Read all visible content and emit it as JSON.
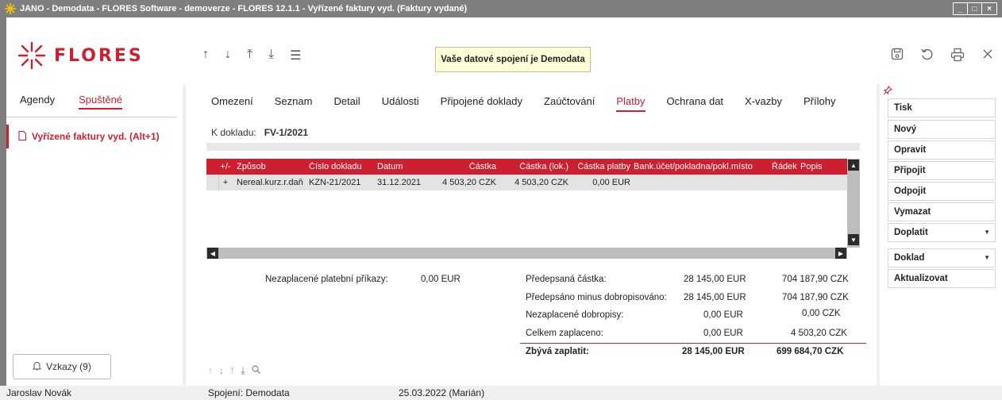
{
  "window": {
    "title": "JANO - Demodata - FLORES Software - demoverze - FLORES 12.1.1 - Vyřízené faktury vyd.  (Faktury vydané)",
    "controls": [
      "_",
      "□",
      "×"
    ]
  },
  "toolbar": {
    "logo_text": "FLORES",
    "nav_icons": [
      "arrow-up-icon",
      "arrow-down-icon",
      "arrow-first-icon",
      "arrow-last-icon",
      "menu-icon"
    ],
    "connection_banner": "Vaše datové spojení je Demodata",
    "right_icons": [
      "save-icon",
      "undo-icon",
      "print-icon",
      "close-icon"
    ]
  },
  "left_panel": {
    "tabs": [
      {
        "label": "Agendy",
        "active": false
      },
      {
        "label": "Spuštěné",
        "active": true
      }
    ],
    "items": [
      {
        "label": "Vyřízené faktury vyd. (Alt+1)"
      }
    ],
    "messages_button": "Vzkazy (9)"
  },
  "main": {
    "tabs": [
      {
        "label": "Omezení",
        "active": false
      },
      {
        "label": "Seznam",
        "active": false
      },
      {
        "label": "Detail",
        "active": false
      },
      {
        "label": "Události",
        "active": false
      },
      {
        "label": "Připojené doklady",
        "active": false
      },
      {
        "label": "Zaúčtování",
        "active": false
      },
      {
        "label": "Platby",
        "active": true
      },
      {
        "label": "Ochrana dat",
        "active": false
      },
      {
        "label": "X-vazby",
        "active": false
      },
      {
        "label": "Přílohy",
        "active": false
      }
    ],
    "doc_label": "K dokladu:",
    "doc_number": "FV-1/2021",
    "grid": {
      "columns": [
        "+/-",
        "Způsob",
        "Číslo dokladu",
        "Datum",
        "Částka",
        "Částka (lok.)",
        "Částka platby",
        "Bank.účet/pokladna/pokl.místo",
        "Řádek",
        "Popis"
      ],
      "rows": [
        [
          "+",
          "Nereal.kurz.r.daň",
          "KZN-21/2021",
          "31.12.2021",
          "4 503,20 CZK",
          "4 503,20 CZK",
          "0,00 EUR",
          "",
          "",
          ""
        ]
      ]
    },
    "summary": {
      "unpaid_orders_label": "Nezaplacené platební příkazy:",
      "unpaid_orders_value": "0,00 EUR",
      "lines": [
        {
          "label": "Předepsaná částka:",
          "eur": "28 145,00 EUR",
          "czk": "704 187,90 CZK"
        },
        {
          "label": "Předepsáno minus dobropisováno:",
          "eur": "28 145,00 EUR",
          "czk": "704 187,90 CZK"
        },
        {
          "label": "Nezaplacené dobropisy:",
          "eur": "0,00 EUR",
          "czk": "0,00 CZK"
        },
        {
          "label": "Celkem zaplaceno:",
          "eur": "0,00 EUR",
          "czk": "4 503,20 CZK"
        }
      ],
      "remaining": {
        "label": "Zbývá zaplatit:",
        "eur": "28 145,00 EUR",
        "czk": "699 684,70 CZK"
      }
    }
  },
  "right_panel": {
    "buttons": [
      {
        "label": "Tisk"
      },
      {
        "label": "Nový"
      },
      {
        "label": "Opravit"
      },
      {
        "label": "Připojit"
      },
      {
        "label": "Odpojit"
      },
      {
        "label": "Vymazat"
      },
      {
        "label": "Doplatit"
      },
      {
        "label": "Doklad"
      },
      {
        "label": "Aktualizovat"
      }
    ]
  },
  "statusbar": {
    "user": "Jaroslav Novák",
    "connection": "Spojení: Demodata",
    "date": "25.03.2022 (Marián)"
  },
  "colors": {
    "accent": "#cc1f2f",
    "titlebar": "#7f7f7f",
    "banner_bg": "#fffdd8"
  }
}
